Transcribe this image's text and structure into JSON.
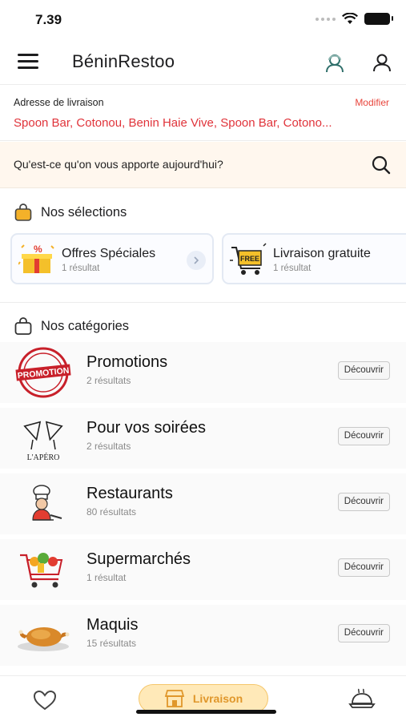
{
  "status_bar": {
    "time": "7.39"
  },
  "header": {
    "title": "BéninRestoo",
    "menu_icon": "hamburger-menu-icon",
    "icons": [
      "support-agent-icon",
      "profile-icon"
    ]
  },
  "delivery": {
    "label": "Adresse de livraison",
    "modify_label": "Modifier",
    "address": "Spoon Bar, Cotonou, Benin Haie Vive,  Spoon Bar, Cotono..."
  },
  "search": {
    "placeholder": "Qu'est-ce qu'on vous apporte aujourd'hui?",
    "icon": "search-icon"
  },
  "selections": {
    "title": "Nos sélections",
    "items": [
      {
        "title": "Offres Spéciales",
        "count": "1 résultat",
        "icon": "gift-percent-icon"
      },
      {
        "title": "Livraison gratuite",
        "count": "1 résultat",
        "icon": "free-delivery-cart-icon"
      }
    ]
  },
  "categories": {
    "title": "Nos catégories",
    "button_label": "Découvrir",
    "items": [
      {
        "title": "Promotions",
        "count": "2 résultats",
        "image": "promotion-stamp",
        "stamp_text": "PROMOTION"
      },
      {
        "title": "Pour vos soirées",
        "count": "2 résultats",
        "image": "apero-glasses",
        "stamp_text": "L'APÉRO"
      },
      {
        "title": "Restaurants",
        "count": "80 résultats",
        "image": "chef-icon"
      },
      {
        "title": "Supermarchés",
        "count": "1 résultat",
        "image": "grocery-cart-icon"
      },
      {
        "title": "Maquis",
        "count": "15 résultats",
        "image": "roast-chicken-icon"
      }
    ]
  },
  "bottom_nav": {
    "items": [
      {
        "icon": "heart-icon"
      },
      {
        "icon": "store-icon",
        "label": "Livraison",
        "active": true
      },
      {
        "icon": "dish-icon"
      }
    ]
  },
  "colors": {
    "accent_red": "#e0333a",
    "highlight_bg": "#fff7ee",
    "nav_active_bg": "#ffe9b8",
    "nav_active_text": "#e0972b"
  }
}
